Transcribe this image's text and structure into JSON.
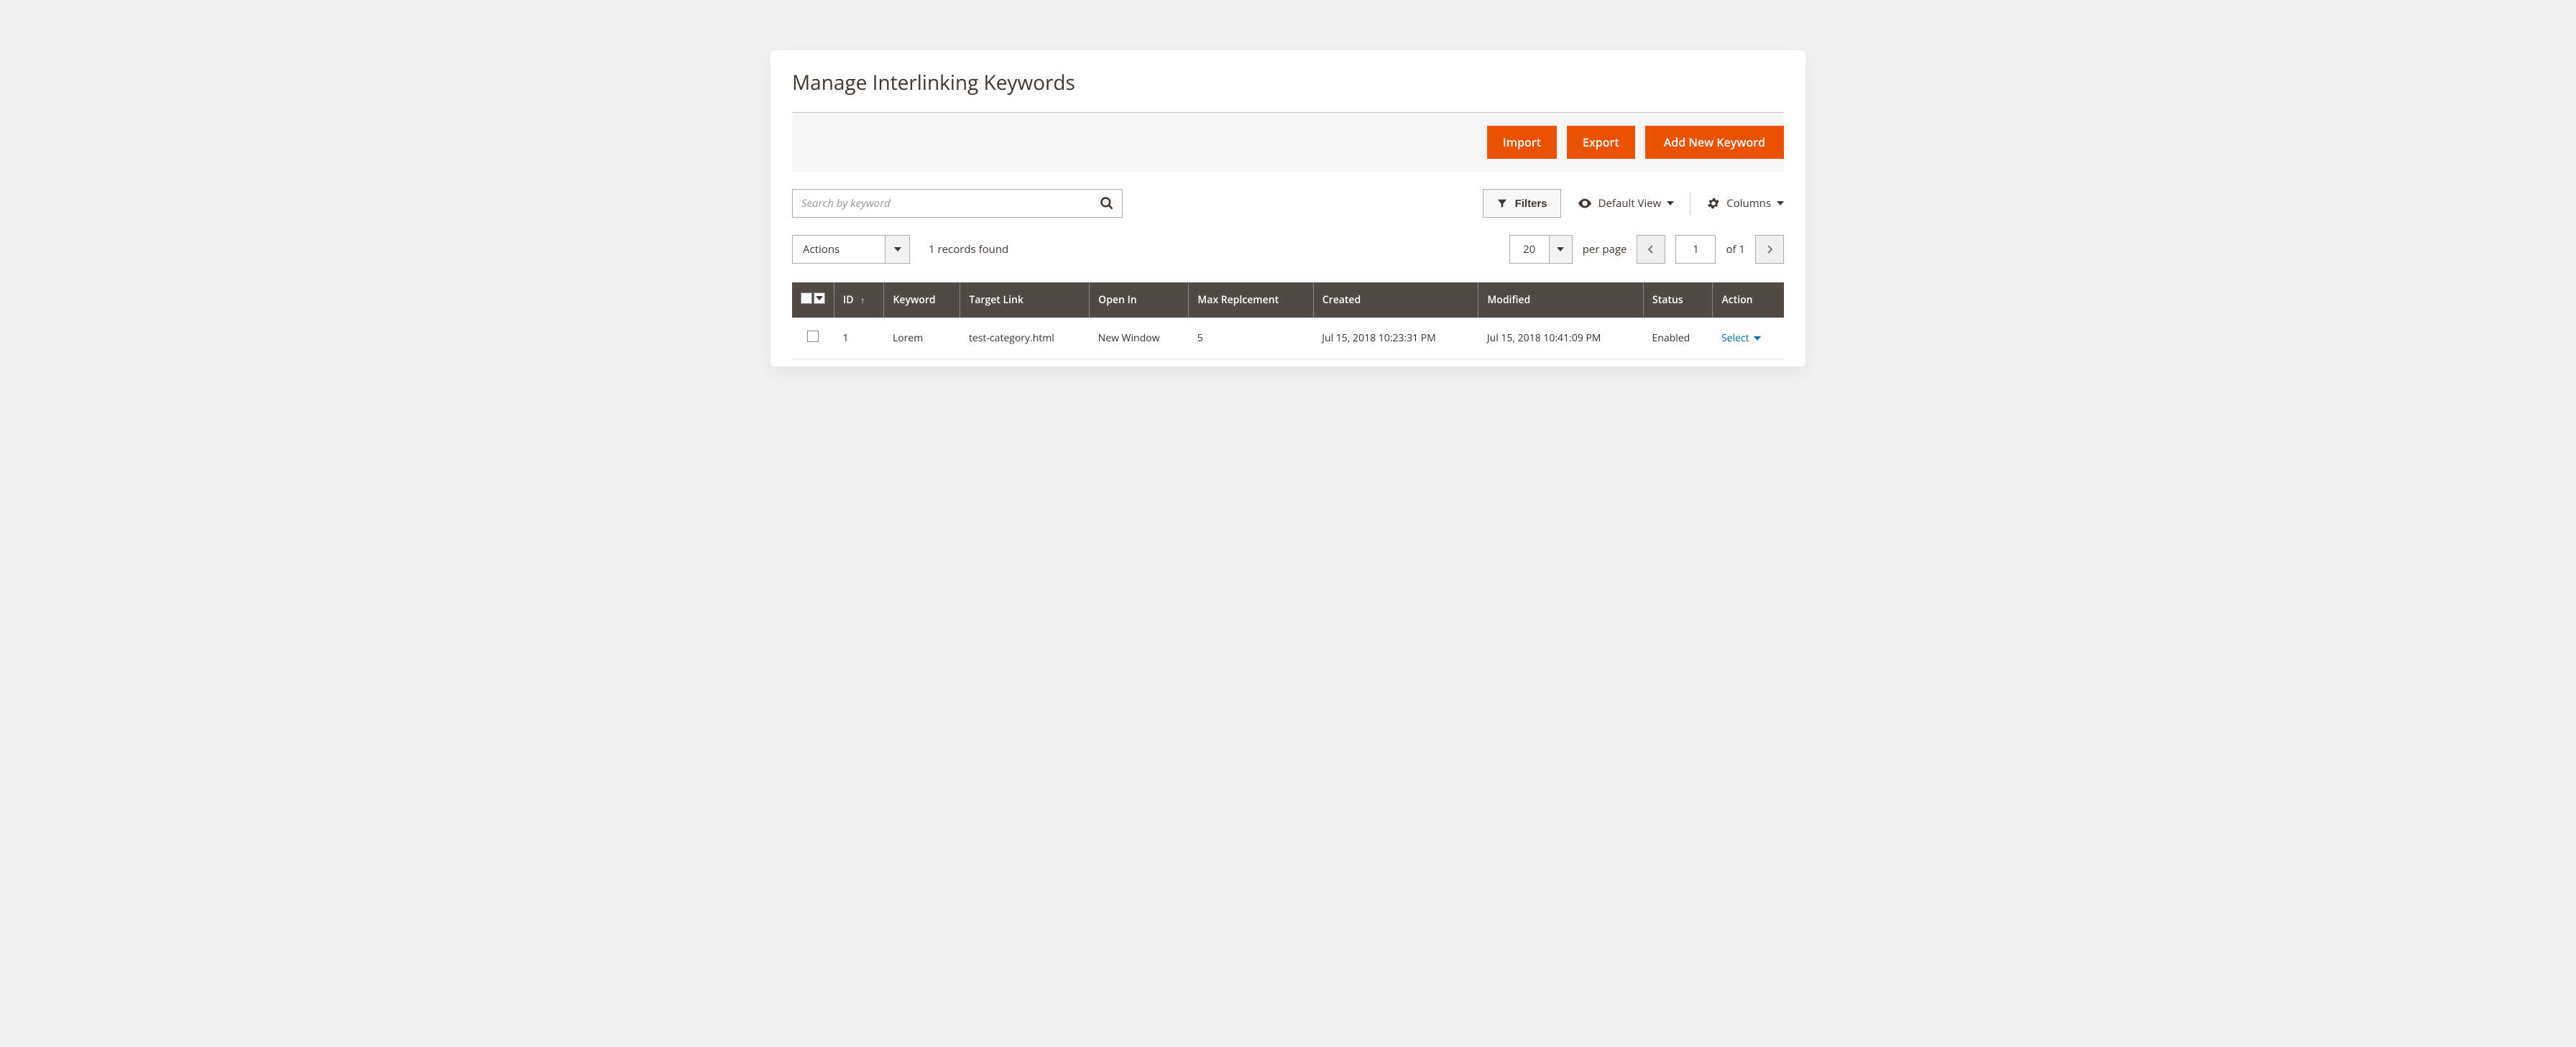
{
  "page": {
    "title": "Manage Interlinking Keywords"
  },
  "toolbar": {
    "import_label": "Import",
    "export_label": "Export",
    "add_label": "Add New Keyword"
  },
  "search": {
    "placeholder": "Search by keyword"
  },
  "controls": {
    "filters_label": "Filters",
    "view_label": "Default View",
    "columns_label": "Columns"
  },
  "actions": {
    "label": "Actions"
  },
  "records": {
    "text": "1 records found"
  },
  "pager": {
    "page_size": "20",
    "per_page_label": "per page",
    "current_page": "1",
    "of_label": "of 1"
  },
  "table": {
    "headers": {
      "id": "ID",
      "keyword": "Keyword",
      "target_link": "Target Link",
      "open_in": "Open In",
      "max_replacement": "Max Replcement",
      "created": "Created",
      "modified": "Modified",
      "status": "Status",
      "action": "Action"
    },
    "rows": [
      {
        "id": "1",
        "keyword": "Lorem",
        "target_link": "test-category.html",
        "open_in": "New Window",
        "max_replacement": "5",
        "created": "Jul 15, 2018 10:23:31 PM",
        "modified": "Jul 15, 2018 10:41:09 PM",
        "status": "Enabled",
        "action_label": "Select"
      }
    ]
  }
}
